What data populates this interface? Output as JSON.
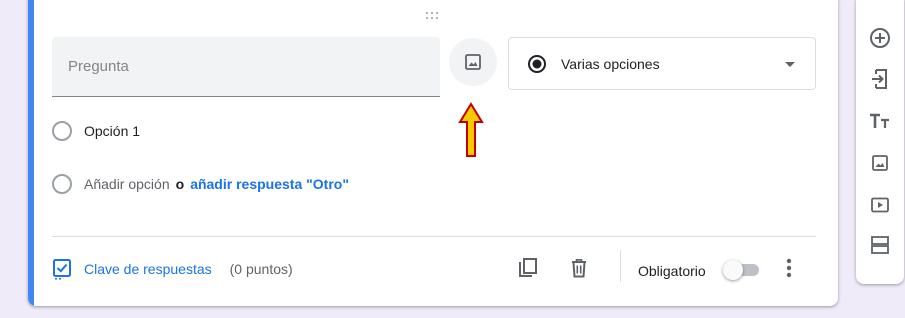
{
  "question": {
    "placeholder": "Pregunta",
    "type_selected": "Varias opciones"
  },
  "options": [
    {
      "label": "Opción 1"
    }
  ],
  "add_option": {
    "add_label": "Añadir opción",
    "or_label": "o",
    "other_link": "añadir respuesta \"Otro\""
  },
  "footer": {
    "answer_key_label": "Clave de respuestas",
    "points_label": "(0 puntos)",
    "required_label": "Obligatorio",
    "required_on": false
  },
  "icons": {
    "image": "image-icon",
    "copy": "copy-icon",
    "delete": "trash-icon",
    "more": "more-vert-icon",
    "answer_key": "checkbox-checked-icon",
    "add_question": "add-circle-icon",
    "import": "import-icon",
    "title": "title-text-icon",
    "add_image": "image-icon",
    "add_video": "video-icon",
    "add_section": "section-icon"
  },
  "colors": {
    "accent": "#4285f4",
    "link": "#1a73e8",
    "arrow_fill": "#f9c900",
    "arrow_stroke": "#c00000",
    "background": "#f0ebf8"
  }
}
